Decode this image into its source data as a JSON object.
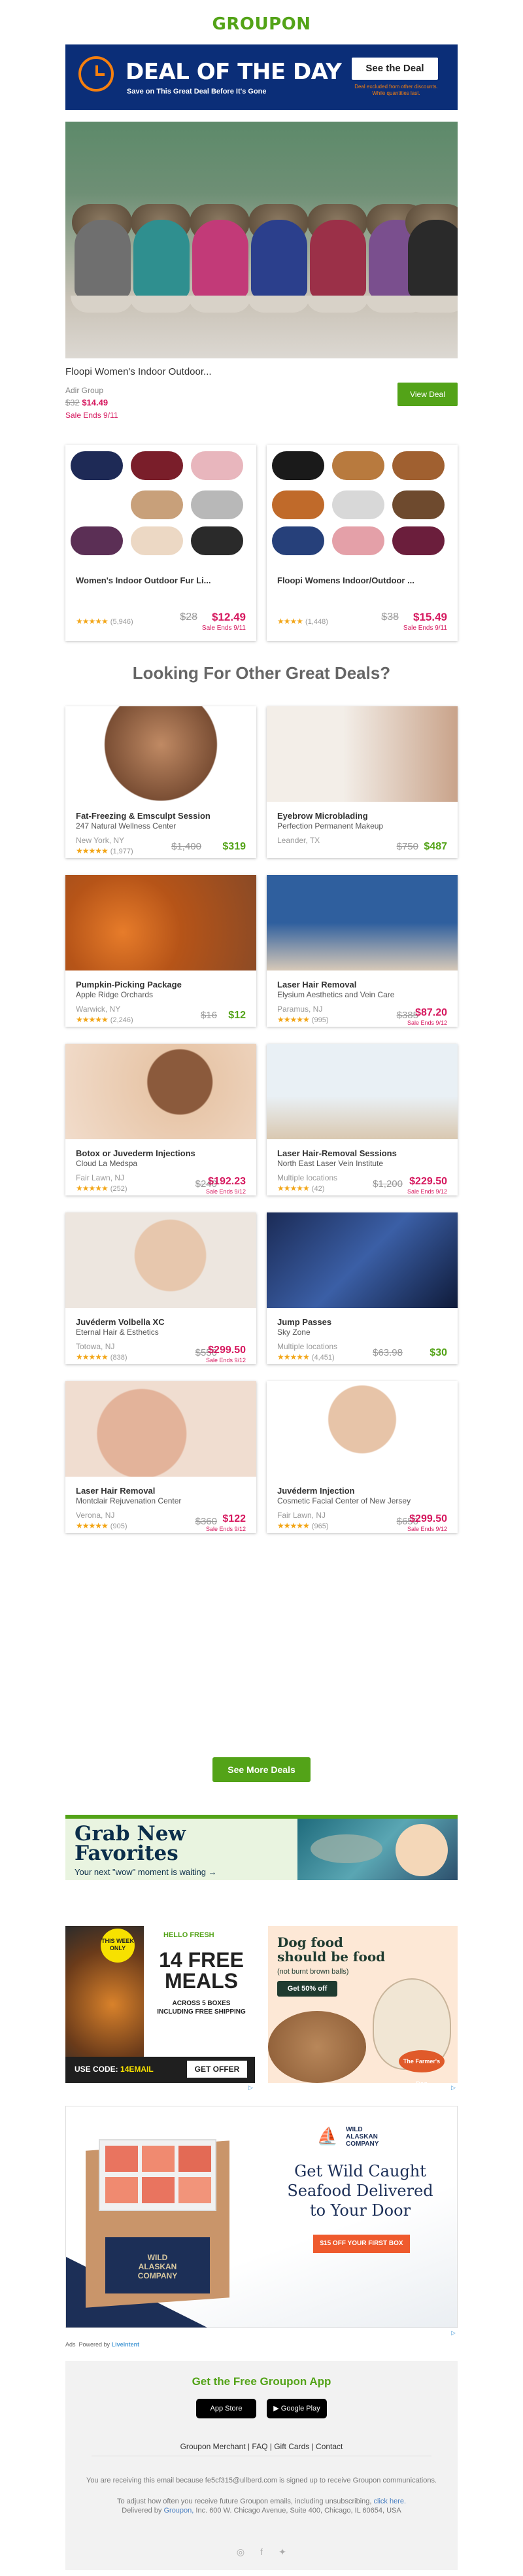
{
  "brand": {
    "logo": "GROUPON",
    "accent": "#53a318",
    "pink": "#d6195f",
    "navy": "#0b2e78",
    "orange": "#f57f0e"
  },
  "dotd": {
    "title": "DEAL OF THE DAY",
    "subtitle": "Save on This Great Deal Before It's Gone",
    "button": "See the Deal",
    "fine_print": "Deal excluded from other discounts. While quantities last."
  },
  "hero": {
    "title": "Floopi Women's Indoor Outdoor...",
    "merchant": "Adir Group",
    "old_price": "$32",
    "new_price": "$14.49",
    "ends": "Sale Ends 9/11",
    "button": "View Deal"
  },
  "product_cards": [
    {
      "title": "Women's Indoor Outdoor Fur Li...",
      "stars": "★★★★★",
      "reviews": "(5,946)",
      "old": "$28",
      "new": "$12.49",
      "ends": "Sale Ends 9/11"
    },
    {
      "title": "Floopi Womens Indoor/Outdoor ...",
      "stars": "★★★★",
      "reviews": "(1,448)",
      "old": "$38",
      "new": "$15.49",
      "ends": "Sale Ends 9/11"
    }
  ],
  "section_heading": "Looking For Other Great Deals?",
  "deals": [
    {
      "title": "Fat-Freezing & Emsculpt Session",
      "merchant": "247 Natural Wellness Center",
      "location": "New York, NY",
      "stars": "★★★★★",
      "reviews": "(1,977)",
      "old": "$1,400",
      "new": "$319",
      "ends": "",
      "color": "green"
    },
    {
      "title": "Eyebrow Microblading",
      "merchant": "Perfection Permanent Makeup",
      "location": "Leander, TX",
      "stars": "",
      "reviews": "",
      "old": "$750",
      "new": "$487",
      "ends": "",
      "color": "green"
    },
    {
      "title": "Pumpkin-Picking Package",
      "merchant": "Apple Ridge Orchards",
      "location": "Warwick, NY",
      "stars": "★★★★★",
      "reviews": "(2,246)",
      "old": "$16",
      "new": "$12",
      "ends": "",
      "color": "green"
    },
    {
      "title": "Laser Hair Removal",
      "merchant": "Elysium Aesthetics and Vein Care",
      "location": "Paramus, NJ",
      "stars": "★★★★★",
      "reviews": "(995)",
      "old": "$385",
      "new": "$87.20",
      "ends": "Sale Ends 9/12",
      "color": "pink"
    },
    {
      "title": "Botox or Juvederm Injections",
      "merchant": "Cloud La Medspa",
      "location": "Fair Lawn, NJ",
      "stars": "★★★★★",
      "reviews": "(252)",
      "old": "$240",
      "new": "$192.23",
      "ends": "Sale Ends 9/12",
      "color": "pink"
    },
    {
      "title": "Laser Hair-Removal Sessions",
      "merchant": "North East Laser Vein Institute",
      "location": "Multiple locations",
      "stars": "★★★★★",
      "reviews": "(42)",
      "old": "$1,200",
      "new": "$229.50",
      "ends": "Sale Ends 9/12",
      "color": "pink"
    },
    {
      "title": "Juvéderm Volbella XC",
      "merchant": "Eternal Hair & Esthetics",
      "location": "Totowa, NJ",
      "stars": "★★★★★",
      "reviews": "(838)",
      "old": "$550",
      "new": "$299.50",
      "ends": "Sale Ends 9/12",
      "color": "pink"
    },
    {
      "title": "Jump Passes",
      "merchant": "Sky Zone",
      "location": "Multiple locations",
      "stars": "★★★★★",
      "reviews": "(4,451)",
      "old": "$63.98",
      "new": "$30",
      "ends": "",
      "color": "green"
    },
    {
      "title": "Laser Hair Removal",
      "merchant": "Montclair Rejuvenation Center",
      "location": "Verona, NJ",
      "stars": "★★★★★",
      "reviews": "(905)",
      "old": "$360",
      "new": "$122",
      "ends": "Sale Ends 9/12",
      "color": "pink"
    },
    {
      "title": "Juvéderm Injection",
      "merchant": "Cosmetic Facial Center of New Jersey",
      "location": "Fair Lawn, NJ",
      "stars": "★★★★★",
      "reviews": "(965)",
      "old": "$650",
      "new": "$299.50",
      "ends": "Sale Ends 9/12",
      "color": "pink"
    }
  ],
  "more_button": "See More Deals",
  "grab": {
    "title_1": "Grab New",
    "title_2": "Favorites",
    "subtitle": "Your next \"wow\" moment is waiting →"
  },
  "ad_hellofresh": {
    "brand": "HELLO FRESH",
    "badge": "THIS WEEK ONLY",
    "headline_1": "14 FREE",
    "headline_2": "MEALS",
    "sub_1": "ACROSS 5 BOXES",
    "sub_2": "INCLUDING FREE SHIPPING",
    "code_label": "USE CODE:",
    "code": "14EMAIL",
    "cta": "GET OFFER"
  },
  "ad_farmers": {
    "headline_1": "Dog food",
    "headline_2": "should be food",
    "sub": "(not burnt brown balls)",
    "cta": "Get 50% off",
    "brand": "The Farmer's Dog"
  },
  "ad_alaskan": {
    "brand_1": "WILD",
    "brand_2": "ALASKAN",
    "brand_3": "COMPANY",
    "headline_1": "Get Wild Caught",
    "headline_2": "Seafood Delivered",
    "headline_3": "to Your Door",
    "cta": "$15 OFF YOUR FIRST BOX"
  },
  "powered": {
    "ads": "Ads",
    "label": "Powered by",
    "brand": "LiveIntent"
  },
  "footer": {
    "app_heading": "Get the Free Groupon App",
    "app_store": "App Store",
    "google_play": "Google Play",
    "links": "Groupon Merchant | FAQ | Gift Cards | Contact",
    "line_1": "You are receiving this email because fe5cf315@ullberd.com is signed up to receive Groupon communications.",
    "line_2a": "To adjust how often you receive future Groupon emails, including unsubscribing,",
    "line_2b": "click here.",
    "line_3a": "Delivered by",
    "line_3b": "Groupon,",
    "line_3c": "Inc. 600 W. Chicago Avenue, Suite 400, Chicago, IL 60654, USA"
  }
}
